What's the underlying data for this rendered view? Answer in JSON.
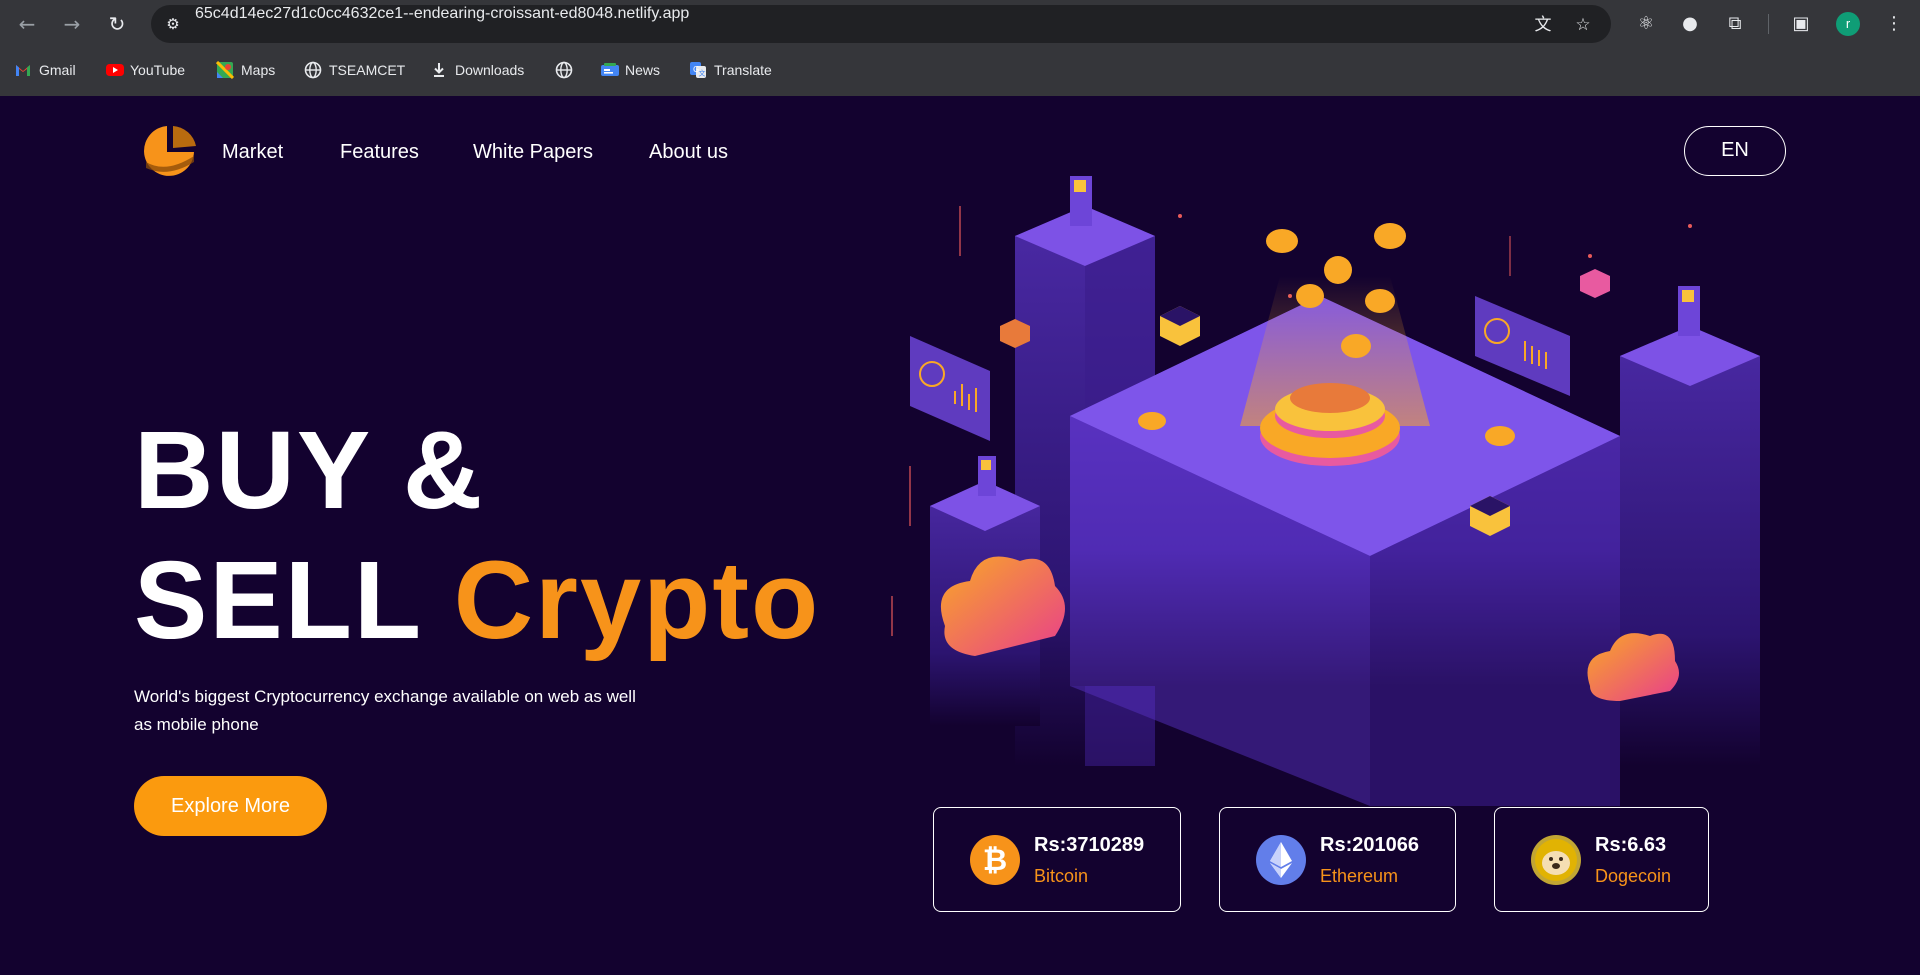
{
  "browser": {
    "url": "65c4d14ec27d1c0cc4632ce1--endearing-croissant-ed8048.netlify.app",
    "profile_initial": "r",
    "bookmarks": [
      {
        "label": "Gmail",
        "icon": "gmail-icon"
      },
      {
        "label": "YouTube",
        "icon": "youtube-icon"
      },
      {
        "label": "Maps",
        "icon": "maps-icon"
      },
      {
        "label": "TSEAMCET",
        "icon": "globe-icon"
      },
      {
        "label": "Downloads",
        "icon": "download-icon"
      },
      {
        "label": "",
        "icon": "globe-icon"
      },
      {
        "label": "News",
        "icon": "news-icon"
      },
      {
        "label": "Translate",
        "icon": "translate-icon"
      }
    ]
  },
  "nav": {
    "links": [
      "Market",
      "Features",
      "White Papers",
      "About us"
    ],
    "language": "EN"
  },
  "hero": {
    "title_line1": "BUY &",
    "title_line2_white": "SELL ",
    "title_line2_accent": "Crypto",
    "subtitle": "World's biggest Cryptocurrency exchange available on web as well as mobile phone",
    "cta": "Explore More"
  },
  "coins": [
    {
      "price": "Rs:3710289",
      "name": "Bitcoin",
      "icon": "bitcoin-icon"
    },
    {
      "price": "Rs:201066",
      "name": "Ethereum",
      "icon": "ethereum-icon"
    },
    {
      "price": "Rs:6.63",
      "name": "Dogecoin",
      "icon": "dogecoin-icon"
    }
  ],
  "colors": {
    "background": "#13022f",
    "accent": "#f7931a",
    "button": "#fb9a0e",
    "illustration_purple": "#6b3fd6"
  }
}
